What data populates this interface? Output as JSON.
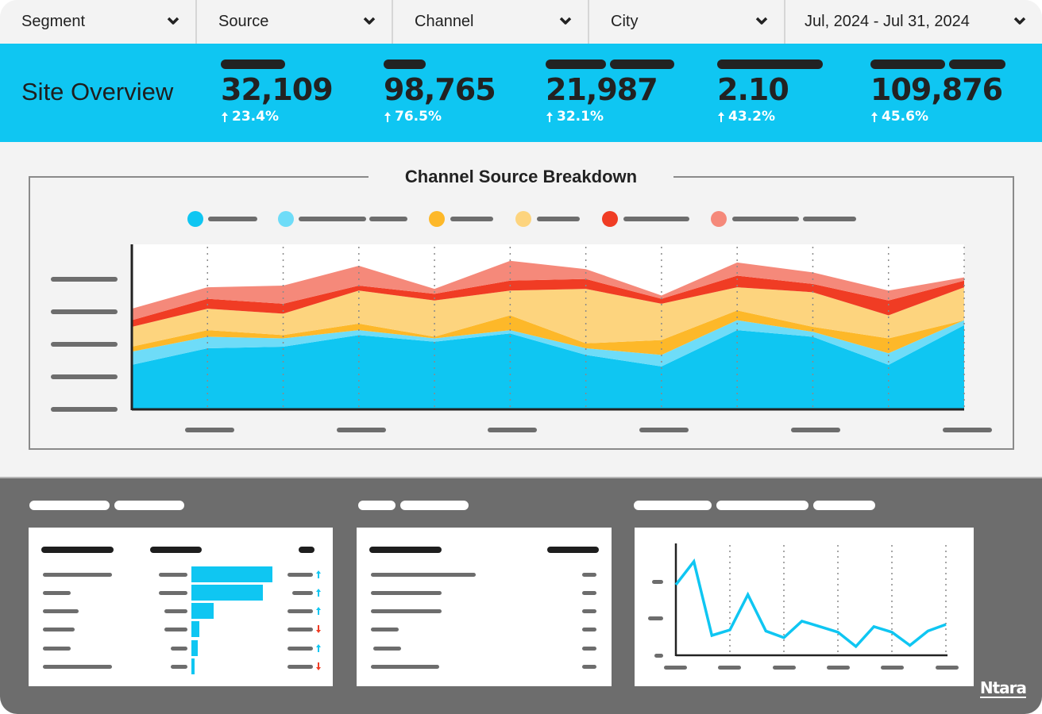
{
  "filters": [
    {
      "label": "Segment",
      "icon": "chevron-down-icon"
    },
    {
      "label": "Source",
      "icon": "chevron-down-icon"
    },
    {
      "label": "Channel",
      "icon": "chevron-down-icon"
    },
    {
      "label": "City",
      "icon": "chevron-down-icon"
    },
    {
      "label": "Jul, 2024 - Jul 31, 2024",
      "icon": "chevron-down-icon"
    }
  ],
  "overview": {
    "title": "Site Overview",
    "kpis": [
      {
        "value": "32,109",
        "change": "23.4%",
        "direction": "up"
      },
      {
        "value": "98,765",
        "change": "76.5%",
        "direction": "up"
      },
      {
        "value": "21,987",
        "change": "32.1%",
        "direction": "up"
      },
      {
        "value": "2.10",
        "change": "43.2%",
        "direction": "up"
      },
      {
        "value": "109,876",
        "change": "45.6%",
        "direction": "up"
      }
    ]
  },
  "colors": {
    "accent": "#0fc6f2",
    "series": [
      "#0fc6f2",
      "#6edcf8",
      "#fdb829",
      "#fdd47e",
      "#f03c24",
      "#f5897a"
    ],
    "up": "#0fc6f2",
    "down": "#f03c24"
  },
  "chart_data": [
    {
      "type": "area",
      "stacked": true,
      "title": "Channel Source Breakdown",
      "xlabel": "",
      "ylabel": "",
      "x": [
        1,
        2,
        3,
        4,
        5,
        6,
        7,
        8,
        9,
        10,
        11,
        12
      ],
      "ylim": [
        0,
        100
      ],
      "legend": "top",
      "grid": "vertical-dotted",
      "series": [
        {
          "name": "series-1",
          "values": [
            27,
            37,
            38,
            45,
            41,
            46,
            33,
            26,
            48,
            44,
            27,
            51
          ]
        },
        {
          "name": "series-2",
          "values": [
            8,
            7,
            5,
            3,
            2,
            2,
            4,
            7,
            6,
            3,
            7,
            3
          ]
        },
        {
          "name": "series-3",
          "values": [
            3,
            4,
            2,
            4,
            1,
            9,
            3,
            9,
            6,
            3,
            9,
            0
          ]
        },
        {
          "name": "series-4",
          "values": [
            12,
            13,
            13,
            20,
            22,
            15,
            33,
            22,
            14,
            21,
            14,
            20
          ]
        },
        {
          "name": "series-5",
          "values": [
            4,
            6,
            6,
            3,
            4,
            6,
            6,
            3,
            7,
            5,
            9,
            4
          ]
        },
        {
          "name": "series-6",
          "values": [
            7,
            7,
            11,
            12,
            3,
            12,
            6,
            2,
            8,
            7,
            6,
            2
          ]
        }
      ]
    },
    {
      "type": "bar",
      "orientation": "horizontal",
      "title": "",
      "categories": [
        "row-1",
        "row-2",
        "row-3",
        "row-4",
        "row-5",
        "row-6"
      ],
      "values": [
        100,
        88,
        27,
        10,
        8,
        4
      ],
      "trends": [
        "up",
        "up",
        "up",
        "down",
        "up",
        "down"
      ]
    },
    {
      "type": "line",
      "title": "",
      "x": [
        1,
        2,
        3,
        4,
        5,
        6,
        7,
        8,
        9,
        10,
        11,
        12,
        13,
        14,
        15,
        16
      ],
      "values": [
        64,
        85,
        18,
        23,
        55,
        22,
        16,
        31,
        26,
        21,
        8,
        26,
        21,
        9,
        22,
        28
      ],
      "ylim": [
        0,
        100
      ],
      "grid": "vertical-dotted"
    }
  ],
  "brand": "Ntara"
}
